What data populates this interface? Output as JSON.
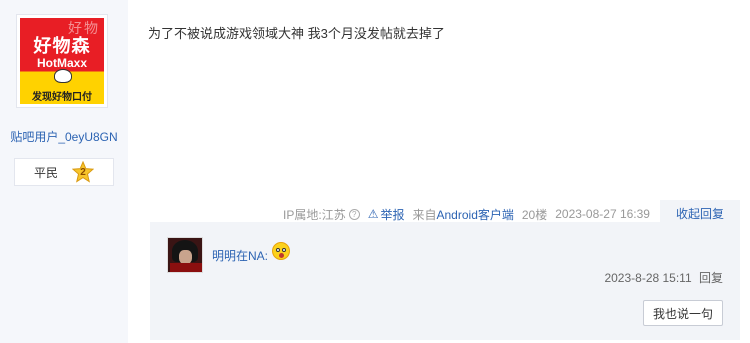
{
  "author": {
    "avatar_text": {
      "line1": "好物森",
      "line2": "HotMaxx",
      "line3": "发现好物口付",
      "watermark": "好物"
    },
    "username": "贴吧用户_0eyU8GN",
    "rank_label": "平民",
    "rank_level": "2",
    "avatar_colors": {
      "top": "#e81e25",
      "bottom": "#ffd200"
    }
  },
  "post": {
    "content": "为了不被说成游戏领域大神 我3个月没发帖就去掉了",
    "ip_location": "IP属地:江苏",
    "help_icon": "?",
    "report_label": "举报",
    "source_prefix": "来自",
    "source_app": "Android客户端",
    "floor": "20楼",
    "timestamp": "2023-08-27 16:39",
    "collapse_reply": "收起回复"
  },
  "reply": {
    "username": "明明在NA:",
    "time": "2023-8-28 15:11",
    "reply_link": "回复",
    "reply_button": "我也说一句"
  },
  "icons": {
    "help": "question-circle-icon",
    "report": "warning-triangle-icon",
    "rank": "star-badge-icon",
    "emoji": "surprised-face-emoji"
  },
  "colors": {
    "link": "#2d64b3",
    "panel": "#f5f7fb",
    "reply_panel": "#f2f4f8"
  }
}
